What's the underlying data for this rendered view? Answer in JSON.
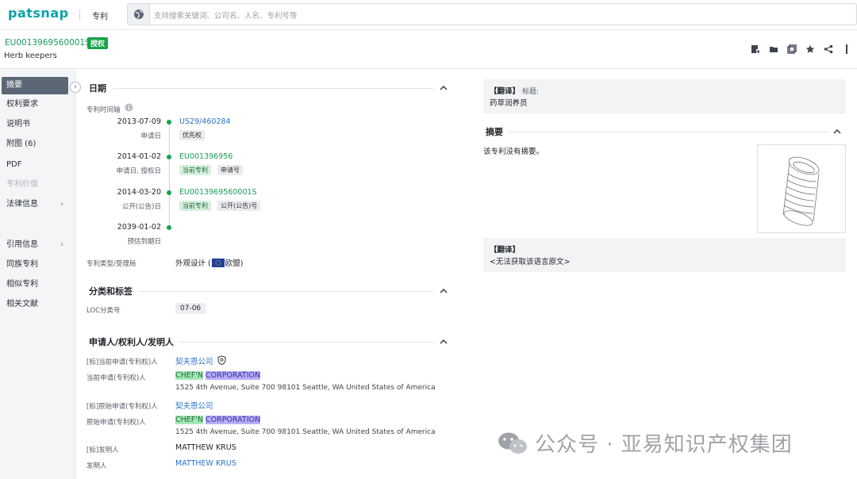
{
  "app": {
    "logo": "patsnap",
    "module": "专利",
    "search_placeholder": "支持搜索关键词、公司名、人名、专利号等"
  },
  "patent": {
    "number": "EU0013969560001S",
    "status_badge": "授权",
    "title": "Herb keepers"
  },
  "header_icons": [
    "add-note-icon",
    "folder-icon",
    "copy-icon",
    "star-icon",
    "share-icon",
    "more-icon"
  ],
  "sidebar": {
    "items": [
      {
        "label": "摘要",
        "active": true
      },
      {
        "label": "权利要求"
      },
      {
        "label": "说明书"
      },
      {
        "label": "附图 (6)"
      },
      {
        "label": "PDF"
      },
      {
        "label": "专利价值",
        "disabled": true
      },
      {
        "label": "法律信息",
        "chevron": "›"
      },
      {
        "label": "引用信息",
        "chevron": "›"
      },
      {
        "label": "同族专利"
      },
      {
        "label": "相似专利"
      },
      {
        "label": "相关文献"
      }
    ]
  },
  "dates": {
    "heading": "日期",
    "timeline_label": "专利时间轴",
    "events": [
      {
        "date": "2013-07-09",
        "sub": "申请日",
        "number": "US29/460284",
        "tags": [
          "优先权"
        ]
      },
      {
        "date": "2014-01-02",
        "sub": "申请日, 授权日",
        "number": "EU001396956",
        "tags": [
          "当前专利",
          "申请号"
        ]
      },
      {
        "date": "2014-03-20",
        "sub": "公开(公告)日",
        "number": "EU0013969560001S",
        "tags": [
          "当前专利",
          "公开(公告)号"
        ]
      },
      {
        "date": "2039-01-02",
        "sub": "预估到期日",
        "number": "",
        "tags": []
      }
    ],
    "type_label": "专利类型/受理局",
    "type_value_prefix": "外观设计 (",
    "type_value_suffix": " 欧盟)"
  },
  "classification": {
    "heading": "分类和标签",
    "loc_label": "LOC分类号",
    "loc_value": "07-06"
  },
  "applicants": {
    "heading": "申请人/权利人/发明人",
    "rows": [
      {
        "label": "[标]当前申请(专利权)人",
        "value": "契夫恩公司"
      },
      {
        "label": "当前申请(专利权)人",
        "name_a": "CHEF'N",
        "name_b": "CORPORATION",
        "address": "1525 4th Avenue, Suite 700 98101 Seattle, WA United States of America"
      },
      {
        "label": "[标]原始申请(专利权)人",
        "value": "契夫恩公司"
      },
      {
        "label": "原始申请(专利权)人",
        "name_a": "CHEF'N",
        "name_b": "CORPORATION",
        "address": "1525 4th Avenue, Suite 700 98101 Seattle, WA United States of America"
      },
      {
        "label": "[标]发明人",
        "value": "MATTHEW KRUS"
      },
      {
        "label": "发明人",
        "value": "MATTHEW KRUS"
      }
    ]
  },
  "right": {
    "translate_tag": "【翻译】",
    "title_label": "标题:",
    "title_translation": "药草润养员",
    "abstract_heading": "摘要",
    "abstract_text": "该专利没有摘要。",
    "translate_tag2": "【翻译】",
    "translate_missing": "<无法获取该语言原文>"
  },
  "watermark": "公众号 · 亚易知识产权集团"
}
